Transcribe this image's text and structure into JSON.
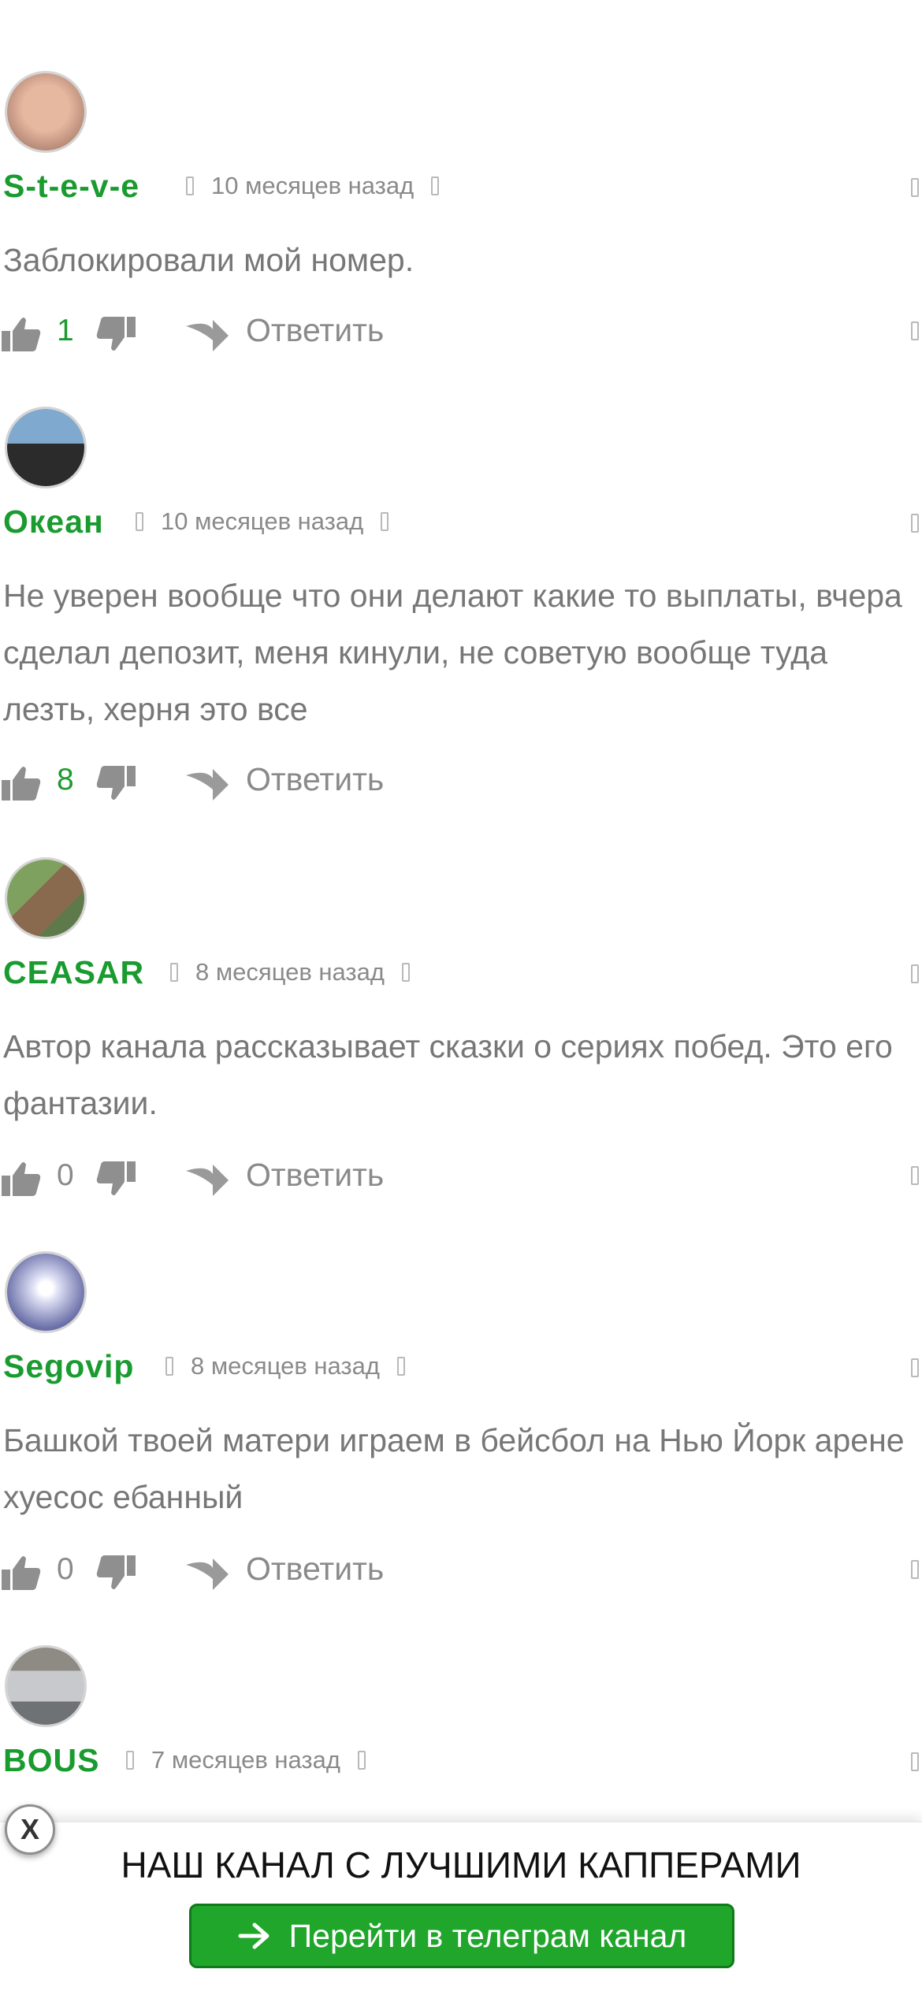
{
  "comments": [
    {
      "author": "S-t-e-v-e",
      "date": "10 месяцев назад",
      "text": "Заблокировали мой номер.",
      "likes": "1",
      "reply_label": "Ответить",
      "avatar_colors": [
        "#e7b8a0",
        "#b48876"
      ]
    },
    {
      "author": "Океан",
      "date": "10 месяцев назад",
      "text": "Не уверен вообще что они делают какие то выплаты, вчера сделал депозит, меня кинули, не советую вообще туда лезть, херня это все",
      "likes": "8",
      "reply_label": "Ответить",
      "avatar_colors": [
        "#5a89b4",
        "#2b2b2b"
      ]
    },
    {
      "author": "CEASAR",
      "date": "8 месяцев назад",
      "text": "Автор канала рассказывает сказки о сериях побед. Это его фантазии.",
      "likes": "0",
      "reply_label": "Ответить",
      "avatar_colors": [
        "#6d8d5a",
        "#8a6a4e"
      ]
    },
    {
      "author": "Segovip",
      "date": "8 месяцев назад",
      "text": "Башкой твоей матери играем в бейсбол на Нью Йорк арене хуесос ебанный",
      "likes": "0",
      "reply_label": "Ответить",
      "avatar_colors": [
        "#dfe1f5",
        "#6a6fa8"
      ]
    },
    {
      "author": "BOUS",
      "date": "7 месяцев назад",
      "avatar_colors": [
        "#c7c9cc",
        "#6f7274"
      ]
    }
  ],
  "banner": {
    "close_label": "X",
    "title": "НАШ КАНАЛ С ЛУЧШИМИ КАППЕРАМИ",
    "button_label": "Перейти в телеграм канал"
  }
}
